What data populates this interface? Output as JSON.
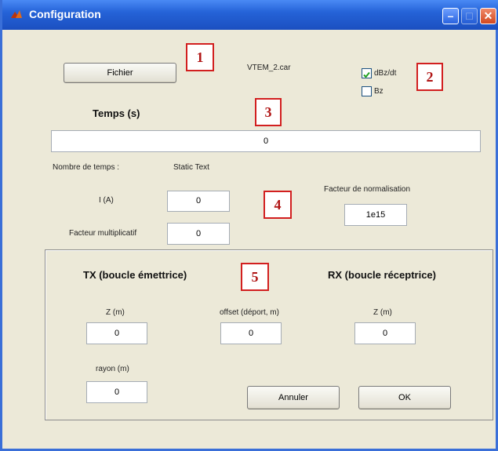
{
  "window": {
    "title": "Configuration",
    "controls": {
      "minimize_icon": "minimize-icon",
      "maximize_icon": "maximize-icon",
      "close_icon": "close-icon"
    }
  },
  "markers": [
    "1",
    "2",
    "3",
    "4",
    "5"
  ],
  "file": {
    "button_label": "Fichier",
    "filename": "VTEM_2.car"
  },
  "options": [
    {
      "label": "dBz/dt",
      "checked": true
    },
    {
      "label": "Bz",
      "checked": false
    }
  ],
  "time": {
    "header": "Temps (s)",
    "value": "0"
  },
  "params": {
    "nombre_label": "Nombre de temps :",
    "static_text": "Static Text",
    "current_label": "I (A)",
    "current_value": "0",
    "facteur_mult_label": "Facteur multiplicatif",
    "facteur_mult_value": "0",
    "norm_label": "Facteur de normalisation",
    "norm_value": "1e15"
  },
  "tx": {
    "header": "TX (boucle émettrice)",
    "z_label": "Z (m)",
    "z_value": "0",
    "rayon_label": "rayon (m)",
    "rayon_value": "0"
  },
  "offset": {
    "label": "offset (déport, m)",
    "value": "0"
  },
  "rx": {
    "header": "RX (boucle réceptrice)",
    "z_label": "Z (m)",
    "z_value": "0"
  },
  "actions": {
    "cancel_label": "Annuler",
    "ok_label": "OK"
  },
  "colors": {
    "titlebar": "#2563d8",
    "window_bg": "#ece9d8",
    "marker_border": "#d21f1f"
  }
}
